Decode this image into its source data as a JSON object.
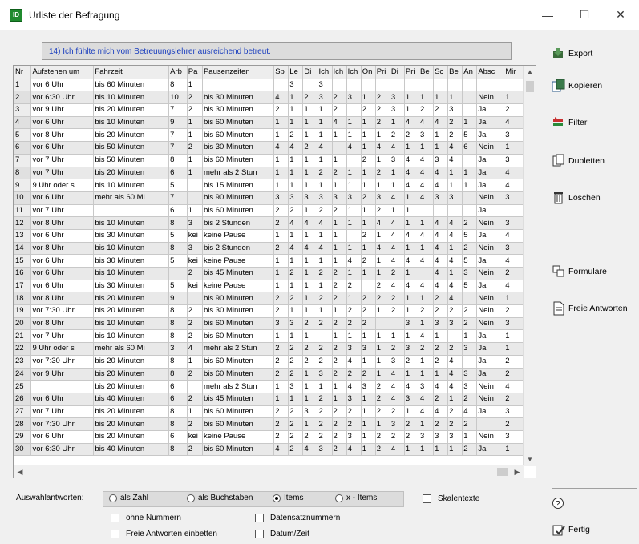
{
  "window": {
    "title": "Urliste der Befragung",
    "minimize": "—",
    "maximize": "☐",
    "close": "✕"
  },
  "question": "14) Ich fühlte mich vom Betreuungslehrer ausreichend betreut.",
  "columns": [
    "Nr",
    "Aufstehen um",
    "Fahrzeit",
    "Arb",
    "Pa",
    "Pausenzeiten",
    "Sp",
    "Le",
    "Di",
    "Ich",
    "Ich",
    "Ich",
    "On",
    "Pri",
    "Di",
    "Pri",
    "Be",
    "Sc",
    "Be",
    "An",
    "Absc",
    "Mir"
  ],
  "rows": [
    [
      "1",
      "vor 6 Uhr",
      "bis 60 Minuten",
      "8",
      "1",
      "",
      "",
      "3",
      "",
      "3",
      "",
      "",
      "",
      "",
      "",
      "",
      "",
      "",
      "",
      "",
      "",
      ""
    ],
    [
      "2",
      "vor 6:30 Uhr",
      "bis 10 Minuten",
      "10",
      "2",
      "bis 30 Minuten",
      "4",
      "1",
      "2",
      "3",
      "2",
      "3",
      "1",
      "2",
      "3",
      "1",
      "1",
      "1",
      "1",
      "",
      "Nein",
      "1"
    ],
    [
      "3",
      "vor 9 Uhr",
      "bis 20 Minuten",
      "7",
      "2",
      "bis 30 Minuten",
      "2",
      "1",
      "1",
      "1",
      "2",
      "",
      "2",
      "2",
      "3",
      "1",
      "2",
      "2",
      "3",
      "",
      "Ja",
      "2"
    ],
    [
      "4",
      "vor 6 Uhr",
      "bis 10 Minuten",
      "9",
      "1",
      "bis 60 Minuten",
      "1",
      "1",
      "1",
      "1",
      "4",
      "1",
      "1",
      "2",
      "1",
      "4",
      "4",
      "4",
      "2",
      "1",
      "Ja",
      "4"
    ],
    [
      "5",
      "vor 8 Uhr",
      "bis 20 Minuten",
      "7",
      "1",
      "bis 60 Minuten",
      "1",
      "2",
      "1",
      "1",
      "1",
      "1",
      "1",
      "1",
      "2",
      "2",
      "3",
      "1",
      "2",
      "5",
      "Ja",
      "3"
    ],
    [
      "6",
      "vor 6 Uhr",
      "bis 50 Minuten",
      "7",
      "2",
      "bis 30 Minuten",
      "4",
      "4",
      "2",
      "4",
      "",
      "4",
      "1",
      "4",
      "4",
      "1",
      "1",
      "1",
      "4",
      "6",
      "Nein",
      "1"
    ],
    [
      "7",
      "vor 7 Uhr",
      "bis 50 Minuten",
      "8",
      "1",
      "bis 60 Minuten",
      "1",
      "1",
      "1",
      "1",
      "1",
      "",
      "2",
      "1",
      "3",
      "4",
      "4",
      "3",
      "4",
      "",
      "Ja",
      "3"
    ],
    [
      "8",
      "vor 7 Uhr",
      "bis 20 Minuten",
      "6",
      "1",
      "mehr als 2 Stun",
      "1",
      "1",
      "1",
      "2",
      "2",
      "1",
      "1",
      "2",
      "1",
      "4",
      "4",
      "4",
      "1",
      "1",
      "Ja",
      "4"
    ],
    [
      "9",
      "9 Uhr oder s",
      "bis 10 Minuten",
      "5",
      "",
      "bis 15 Minuten",
      "1",
      "1",
      "1",
      "1",
      "1",
      "1",
      "1",
      "1",
      "1",
      "4",
      "4",
      "4",
      "1",
      "1",
      "Ja",
      "4"
    ],
    [
      "10",
      "vor 6 Uhr",
      "mehr als 60 Mi",
      "7",
      "",
      "bis 90 Minuten",
      "3",
      "3",
      "3",
      "3",
      "3",
      "3",
      "2",
      "3",
      "4",
      "1",
      "4",
      "3",
      "3",
      "",
      "Nein",
      "3"
    ],
    [
      "11",
      "vor 7 Uhr",
      "",
      "6",
      "1",
      "bis 60 Minuten",
      "2",
      "2",
      "1",
      "2",
      "2",
      "1",
      "1",
      "2",
      "1",
      "1",
      "",
      "",
      "",
      "",
      "Ja",
      ""
    ],
    [
      "12",
      "vor 8 Uhr",
      "bis 10 Minuten",
      "8",
      "3",
      "bis 2 Stunden",
      "2",
      "4",
      "4",
      "4",
      "1",
      "1",
      "1",
      "4",
      "4",
      "1",
      "1",
      "4",
      "4",
      "2",
      "Nein",
      "3"
    ],
    [
      "13",
      "vor 6 Uhr",
      "bis 30 Minuten",
      "5",
      "kei",
      "keine Pause",
      "1",
      "1",
      "1",
      "1",
      "1",
      "",
      "2",
      "1",
      "4",
      "4",
      "4",
      "4",
      "4",
      "5",
      "Ja",
      "4"
    ],
    [
      "14",
      "vor 8 Uhr",
      "bis 10 Minuten",
      "8",
      "3",
      "bis 2 Stunden",
      "2",
      "4",
      "4",
      "4",
      "1",
      "1",
      "1",
      "4",
      "4",
      "1",
      "1",
      "4",
      "1",
      "2",
      "Nein",
      "3"
    ],
    [
      "15",
      "vor 6 Uhr",
      "bis 30 Minuten",
      "5",
      "kei",
      "keine Pause",
      "1",
      "1",
      "1",
      "1",
      "1",
      "4",
      "2",
      "1",
      "4",
      "4",
      "4",
      "4",
      "4",
      "5",
      "Ja",
      "4"
    ],
    [
      "16",
      "vor 6 Uhr",
      "bis 10 Minuten",
      "",
      "2",
      "bis 45 Minuten",
      "1",
      "2",
      "1",
      "2",
      "2",
      "1",
      "1",
      "1",
      "2",
      "1",
      "",
      "4",
      "1",
      "3",
      "Nein",
      "2"
    ],
    [
      "17",
      "vor 6 Uhr",
      "bis 30 Minuten",
      "5",
      "kei",
      "keine Pause",
      "1",
      "1",
      "1",
      "1",
      "2",
      "2",
      "",
      "2",
      "4",
      "4",
      "4",
      "4",
      "4",
      "5",
      "Ja",
      "4"
    ],
    [
      "18",
      "vor 8 Uhr",
      "bis 20 Minuten",
      "9",
      "",
      "bis 90 Minuten",
      "2",
      "2",
      "1",
      "2",
      "2",
      "1",
      "2",
      "2",
      "2",
      "1",
      "1",
      "2",
      "4",
      "",
      "Nein",
      "1"
    ],
    [
      "19",
      "vor 7:30 Uhr",
      "bis 20 Minuten",
      "8",
      "2",
      "bis 30 Minuten",
      "2",
      "1",
      "1",
      "1",
      "1",
      "2",
      "2",
      "1",
      "2",
      "1",
      "2",
      "2",
      "2",
      "2",
      "Nein",
      "2"
    ],
    [
      "20",
      "vor 8 Uhr",
      "bis 10 Minuten",
      "8",
      "2",
      "bis 60 Minuten",
      "3",
      "3",
      "2",
      "2",
      "2",
      "2",
      "2",
      "",
      "",
      "3",
      "1",
      "3",
      "3",
      "2",
      "Nein",
      "3"
    ],
    [
      "21",
      "vor 7 Uhr",
      "bis 10 Minuten",
      "8",
      "2",
      "bis 60 Minuten",
      "1",
      "1",
      "1",
      "",
      "1",
      "1",
      "1",
      "1",
      "1",
      "1",
      "4",
      "1",
      "",
      "1",
      "Ja",
      "1"
    ],
    [
      "22",
      "9 Uhr oder s",
      "mehr als 60 Mi",
      "3",
      "4",
      "mehr als 2 Stun",
      "2",
      "2",
      "2",
      "2",
      "2",
      "3",
      "3",
      "1",
      "2",
      "3",
      "2",
      "2",
      "2",
      "3",
      "Ja",
      "1"
    ],
    [
      "23",
      "vor 7:30 Uhr",
      "bis 20 Minuten",
      "8",
      "1",
      "bis 60 Minuten",
      "2",
      "2",
      "2",
      "2",
      "2",
      "4",
      "1",
      "1",
      "3",
      "2",
      "1",
      "2",
      "4",
      "",
      "Ja",
      "2"
    ],
    [
      "24",
      "vor 9 Uhr",
      "bis 20 Minuten",
      "8",
      "2",
      "bis 60 Minuten",
      "2",
      "2",
      "1",
      "3",
      "2",
      "2",
      "2",
      "1",
      "4",
      "1",
      "1",
      "1",
      "4",
      "3",
      "Ja",
      "2"
    ],
    [
      "25",
      "",
      "bis 20 Minuten",
      "6",
      "",
      "mehr als 2 Stun",
      "1",
      "3",
      "1",
      "1",
      "1",
      "4",
      "3",
      "2",
      "4",
      "4",
      "3",
      "4",
      "4",
      "3",
      "Nein",
      "4"
    ],
    [
      "26",
      "vor 6 Uhr",
      "bis 40 Minuten",
      "6",
      "2",
      "bis 45 Minuten",
      "1",
      "1",
      "1",
      "2",
      "1",
      "3",
      "1",
      "2",
      "4",
      "3",
      "4",
      "2",
      "1",
      "2",
      "Nein",
      "2"
    ],
    [
      "27",
      "vor 7 Uhr",
      "bis 20 Minuten",
      "8",
      "1",
      "bis 60 Minuten",
      "2",
      "2",
      "3",
      "2",
      "2",
      "2",
      "1",
      "2",
      "2",
      "1",
      "4",
      "4",
      "2",
      "4",
      "Ja",
      "3"
    ],
    [
      "28",
      "vor 7:30 Uhr",
      "bis 20 Minuten",
      "8",
      "2",
      "bis 60 Minuten",
      "2",
      "2",
      "1",
      "2",
      "2",
      "2",
      "1",
      "1",
      "3",
      "2",
      "1",
      "2",
      "2",
      "2",
      "",
      "2"
    ],
    [
      "29",
      "vor 6 Uhr",
      "bis 20 Minuten",
      "6",
      "kei",
      "keine Pause",
      "2",
      "2",
      "2",
      "2",
      "2",
      "3",
      "1",
      "2",
      "2",
      "2",
      "3",
      "3",
      "3",
      "1",
      "Nein",
      "3"
    ],
    [
      "30",
      "vor 6:30 Uhr",
      "bis 40 Minuten",
      "8",
      "2",
      "bis 60 Minuten",
      "4",
      "2",
      "4",
      "3",
      "2",
      "4",
      "1",
      "2",
      "4",
      "1",
      "1",
      "1",
      "1",
      "2",
      "Ja",
      "1"
    ]
  ],
  "actions": {
    "export": "Export",
    "kopieren": "Kopieren",
    "filter": "Filter",
    "dubletten": "Dubletten",
    "loeschen": "Löschen",
    "formulare": "Formulare",
    "freie_antworten": "Freie Antworten",
    "help": "?",
    "fertig": "Fertig"
  },
  "options": {
    "label": "Auswahlantworten:",
    "radio": [
      {
        "label": "als Zahl",
        "selected": false
      },
      {
        "label": "als Buchstaben",
        "selected": false
      },
      {
        "label": "Items",
        "selected": true
      },
      {
        "label": "x - Items",
        "selected": false
      }
    ],
    "skalentexte": "Skalentexte",
    "ohne_nummern": "ohne Nummern",
    "datensatznummern": "Datensatznummern",
    "freie_einbetten": "Freie Antworten einbetten",
    "datum_zeit": "Datum/Zeit"
  },
  "colors": {
    "accent_blue": "#1b3fbf",
    "app_icon": "#1f8a2e"
  }
}
